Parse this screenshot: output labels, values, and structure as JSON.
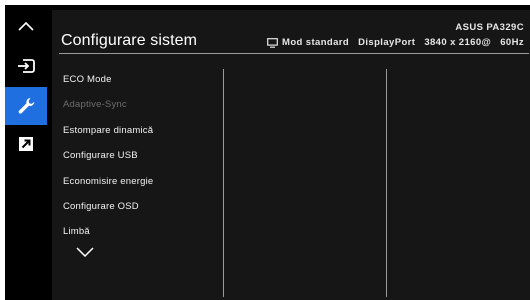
{
  "rail": {
    "items": [
      {
        "icon": "chevron-up-icon",
        "active": false
      },
      {
        "icon": "input-source-icon",
        "active": false
      },
      {
        "icon": "wrench-icon",
        "active": true
      },
      {
        "icon": "shortcut-icon",
        "active": false
      }
    ],
    "accent": "#1f6fe0"
  },
  "header": {
    "title": "Configurare sistem",
    "model": "ASUS PA329C",
    "mode_label": "Mod standard",
    "input": "DisplayPort",
    "resolution": "3840 x 2160@",
    "refresh": "60Hz"
  },
  "menu": {
    "items": [
      {
        "label": "ECO Mode",
        "enabled": true
      },
      {
        "label": "Adaptive-Sync",
        "enabled": false
      },
      {
        "label": "Estompare dinamică",
        "enabled": true
      },
      {
        "label": "Configurare USB",
        "enabled": true
      },
      {
        "label": "Economisire energie",
        "enabled": true
      },
      {
        "label": "Configurare OSD",
        "enabled": true
      },
      {
        "label": "Limbă",
        "enabled": true
      }
    ],
    "more_icon": "chevron-down-icon"
  },
  "colors": {
    "background": "#000000",
    "panel": "#161616",
    "text": "#ffffff",
    "disabled_text": "#6e6e6e",
    "separator": "#9a9a9a"
  }
}
